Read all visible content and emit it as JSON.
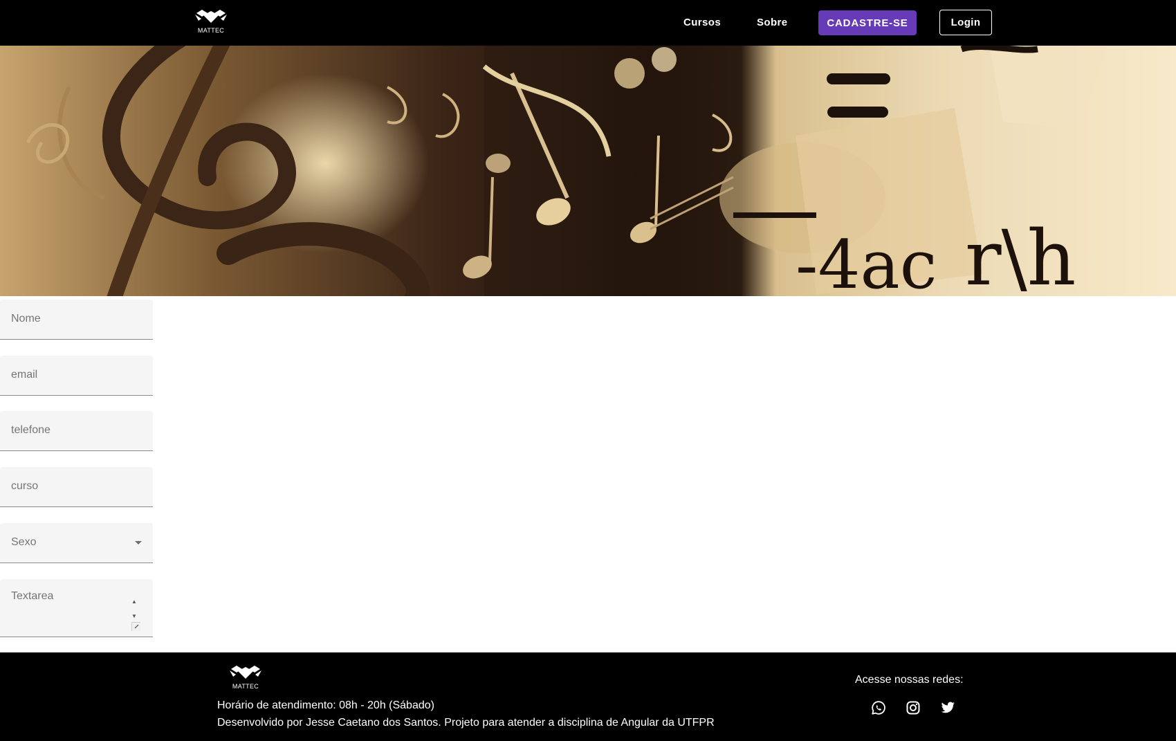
{
  "header": {
    "logo_text": "MATTEC",
    "nav": {
      "cursos": "Cursos",
      "sobre": "Sobre"
    },
    "cadastre_label": "CADASTRE-SE",
    "login_label": "Login"
  },
  "banner": {
    "equation_text": "-4ac",
    "equation_text_2": "r\\h"
  },
  "form": {
    "nome_placeholder": "Nome",
    "email_placeholder": "email",
    "telefone_placeholder": "telefone",
    "curso_placeholder": "curso",
    "sexo_label": "Sexo",
    "textarea_placeholder": "Textarea"
  },
  "footer": {
    "logo_text": "MATTEC",
    "hours": "Horário de atendimento: 08h - 20h (Sábado)",
    "credit": "Desenvolvido por Jesse Caetano dos Santos. Projeto para atender a disciplina de Angular da UTFPR",
    "social_title": "Acesse nossas redes:",
    "social_icons": [
      "whatsapp-icon",
      "instagram-icon",
      "twitter-icon"
    ]
  },
  "colors": {
    "accent": "#673ab7",
    "header_bg": "#000000",
    "field_bg": "#f5f5f5"
  }
}
